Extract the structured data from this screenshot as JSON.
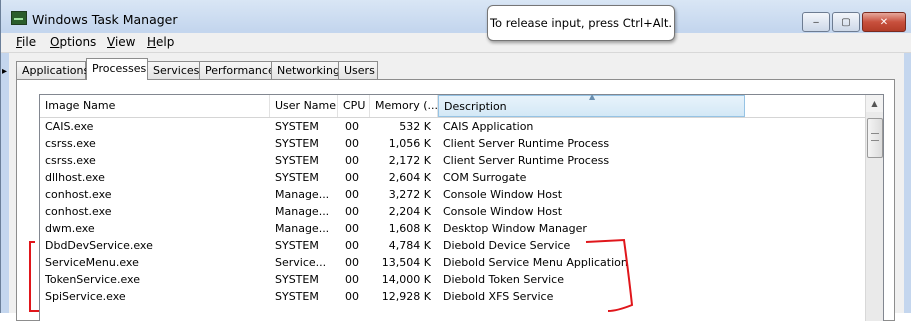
{
  "window": {
    "title": "Windows Task Manager"
  },
  "tooltip": {
    "text": "To release input, press Ctrl+Alt."
  },
  "caption": {
    "minimize": "‒",
    "maximize": "▢",
    "close": "✕"
  },
  "menu": [
    {
      "label": "File",
      "key": "F",
      "rest": "ile"
    },
    {
      "label": "Options",
      "key": "O",
      "rest": "ptions"
    },
    {
      "label": "View",
      "key": "V",
      "rest": "iew"
    },
    {
      "label": "Help",
      "key": "H",
      "rest": "elp"
    }
  ],
  "tabs": [
    "Applications",
    "Processes",
    "Services",
    "Performance",
    "Networking",
    "Users"
  ],
  "active_tab": "Processes",
  "columns": [
    "Image Name",
    "User Name",
    "CPU",
    "Memory (...",
    "Description"
  ],
  "sorted_column": "Description",
  "rows": [
    {
      "name": "CAIS.exe",
      "user": "SYSTEM",
      "cpu": "00",
      "mem": "532 K",
      "desc": "CAIS Application"
    },
    {
      "name": "csrss.exe",
      "user": "SYSTEM",
      "cpu": "00",
      "mem": "1,056 K",
      "desc": "Client Server Runtime Process"
    },
    {
      "name": "csrss.exe",
      "user": "SYSTEM",
      "cpu": "00",
      "mem": "2,172 K",
      "desc": "Client Server Runtime Process"
    },
    {
      "name": "dllhost.exe",
      "user": "SYSTEM",
      "cpu": "00",
      "mem": "2,604 K",
      "desc": "COM Surrogate"
    },
    {
      "name": "conhost.exe",
      "user": "Manage...",
      "cpu": "00",
      "mem": "3,272 K",
      "desc": "Console Window Host"
    },
    {
      "name": "conhost.exe",
      "user": "Manage...",
      "cpu": "00",
      "mem": "2,204 K",
      "desc": "Console Window Host"
    },
    {
      "name": "dwm.exe",
      "user": "Manage...",
      "cpu": "00",
      "mem": "1,608 K",
      "desc": "Desktop Window Manager"
    },
    {
      "name": "DbdDevService.exe",
      "user": "SYSTEM",
      "cpu": "00",
      "mem": "4,784 K",
      "desc": "Diebold Device Service"
    },
    {
      "name": "ServiceMenu.exe",
      "user": "Service...",
      "cpu": "00",
      "mem": "13,504 K",
      "desc": "Diebold Service Menu Application"
    },
    {
      "name": "TokenService.exe",
      "user": "SYSTEM",
      "cpu": "00",
      "mem": "14,000 K",
      "desc": "Diebold Token Service"
    },
    {
      "name": "SpiService.exe",
      "user": "SYSTEM",
      "cpu": "00",
      "mem": "12,928 K",
      "desc": "Diebold XFS Service"
    }
  ],
  "colors": {
    "annotation": "#e0161b",
    "selection_header": "#d3e8f6"
  }
}
